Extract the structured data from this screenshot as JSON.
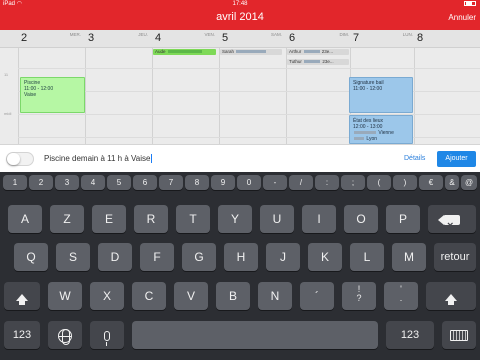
{
  "status_bar": {
    "carrier": "iPad",
    "wifi_icon": "wifi-icon",
    "time": "17:48",
    "battery_icon": "battery-icon"
  },
  "header": {
    "title": "avril 2014",
    "cancel_label": "Annuler",
    "background": "#e2262b"
  },
  "calendar": {
    "days": [
      {
        "number": "2",
        "name": "MER."
      },
      {
        "number": "3",
        "name": "JEU."
      },
      {
        "number": "4",
        "name": "VEN."
      },
      {
        "number": "5",
        "name": "SAM."
      },
      {
        "number": "6",
        "name": "DIM."
      },
      {
        "number": "7",
        "name": "LUN."
      },
      {
        "number": "8",
        "name": ""
      }
    ],
    "allday_events": [
      {
        "label": "Aude",
        "color": "#7ed957"
      },
      {
        "label": "Sarah",
        "color": "#d8d8d8"
      },
      {
        "label": "Arthur",
        "suffix": "23e...",
        "color": "#d8d8d8"
      },
      {
        "label": "Tuthur",
        "suffix": "23e...",
        "color": "#d8d8d8"
      }
    ],
    "hour_labels": [
      "11",
      "midi"
    ],
    "events": [
      {
        "title": "Piscine",
        "time": "11:00 - 12:00",
        "place": "Vaise",
        "color": "#b6f7a4"
      },
      {
        "title": "Signature bail",
        "time": "11:00 - 12:00",
        "color": "#9cc7ea"
      },
      {
        "title": "État des lieux",
        "time": "12:00 - 13:00",
        "line3": "Vienne",
        "line4": "Lyon",
        "color": "#9cc7ea"
      }
    ]
  },
  "input_bar": {
    "text": "Piscine demain à 11 h à Vaise",
    "details_label": "Détails",
    "add_label": "Ajouter",
    "accent": "#1f87e6"
  },
  "keyboard": {
    "number_row": [
      "1",
      "2",
      "3",
      "4",
      "5",
      "6",
      "7",
      "8",
      "9",
      "0",
      "-",
      "/",
      ":",
      ";",
      "(",
      ")",
      "€",
      "&",
      "@"
    ],
    "row1": [
      "A",
      "Z",
      "E",
      "R",
      "T",
      "Y",
      "U",
      "I",
      "O",
      "P"
    ],
    "row2": [
      "Q",
      "S",
      "D",
      "F",
      "G",
      "H",
      "J",
      "K",
      "L",
      "M"
    ],
    "row2_return": "retour",
    "row3": [
      "W",
      "X",
      "C",
      "V",
      "B",
      "N",
      "´"
    ],
    "row3_q": {
      "top": "!",
      "bottom": "?"
    },
    "row3_period": {
      "top": "'",
      "bottom": "."
    },
    "numbers_label": "123",
    "icons": [
      "shift-icon",
      "delete-icon",
      "globe-icon",
      "microphone-icon",
      "keyboard-hide-icon"
    ]
  }
}
